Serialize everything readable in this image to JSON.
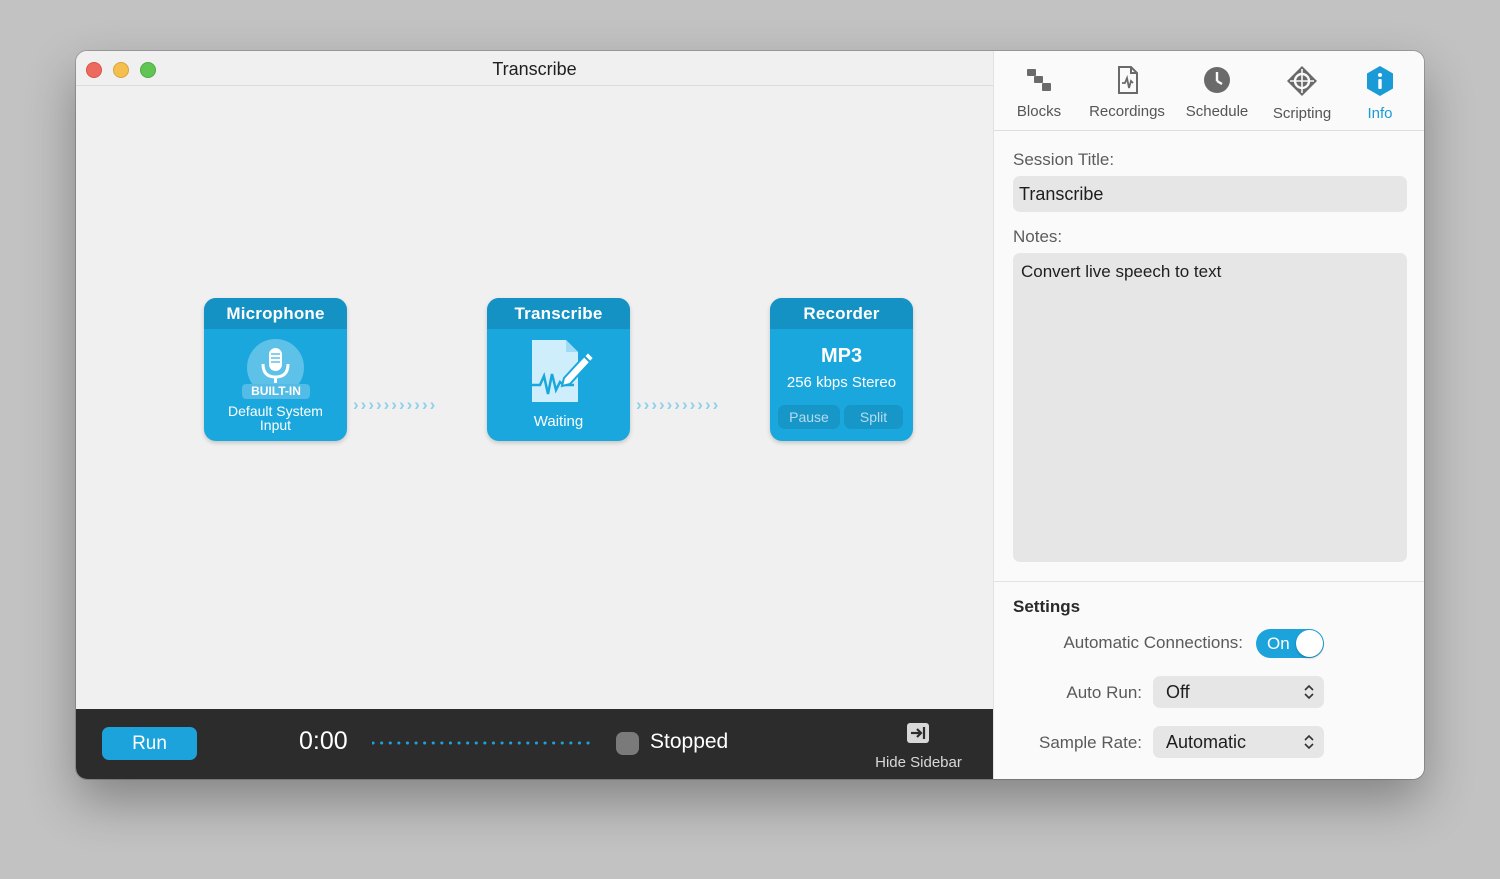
{
  "window": {
    "title": "Transcribe"
  },
  "blocks": {
    "microphone": {
      "title": "Microphone",
      "badge": "BUILT-IN",
      "subtitle_line1": "Default System",
      "subtitle_line2": "Input"
    },
    "transcribe": {
      "title": "Transcribe",
      "status": "Waiting"
    },
    "recorder": {
      "title": "Recorder",
      "format": "MP3",
      "detail": "256 kbps Stereo",
      "pause_label": "Pause",
      "split_label": "Split"
    }
  },
  "connector": {
    "glyphs": "›››››››››››"
  },
  "bottom_bar": {
    "run_label": "Run",
    "time": "0:00",
    "status": "Stopped",
    "hide_sidebar_label": "Hide Sidebar"
  },
  "sidebar": {
    "tabs": [
      {
        "label": "Blocks",
        "icon": "blocks-icon"
      },
      {
        "label": "Recordings",
        "icon": "recordings-icon"
      },
      {
        "label": "Schedule",
        "icon": "clock-icon"
      },
      {
        "label": "Scripting",
        "icon": "scripting-icon"
      },
      {
        "label": "Info",
        "icon": "info-icon",
        "active": true
      }
    ],
    "session_title_label": "Session Title:",
    "session_title_value": "Transcribe",
    "notes_label": "Notes:",
    "notes_value": "Convert live speech to text",
    "settings_heading": "Settings",
    "auto_connections_label": "Automatic Connections:",
    "auto_connections_value": "On",
    "auto_run_label": "Auto Run:",
    "auto_run_value": "Off",
    "sample_rate_label": "Sample Rate:",
    "sample_rate_value": "Automatic"
  },
  "colors": {
    "accent": "#1da3dc",
    "block": "#1aa7dd",
    "block_header": "#1592c4",
    "bottom_bar": "#2c2c2c"
  }
}
